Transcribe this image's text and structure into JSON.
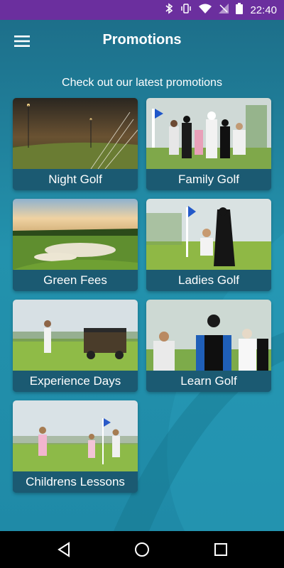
{
  "status_bar": {
    "time": "22:40",
    "icons": [
      "bluetooth-icon",
      "vibrate-icon",
      "wifi-icon",
      "no-sim-icon",
      "battery-icon"
    ]
  },
  "header": {
    "title": "Promotions",
    "menu_icon": "hamburger-menu-icon"
  },
  "subtitle": "Check out our latest promotions",
  "promotions": [
    {
      "label": "Night Golf"
    },
    {
      "label": "Family Golf"
    },
    {
      "label": "Green Fees"
    },
    {
      "label": "Ladies Golf"
    },
    {
      "label": "Experience Days"
    },
    {
      "label": "Learn Golf"
    },
    {
      "label": "Childrens Lessons"
    }
  ],
  "nav_bar": {
    "icons": [
      "back-icon",
      "home-icon",
      "recents-icon"
    ]
  },
  "colors": {
    "status_bar": "#6b2f9e",
    "background": "#2392ad",
    "card_label": "#1b5a72"
  }
}
